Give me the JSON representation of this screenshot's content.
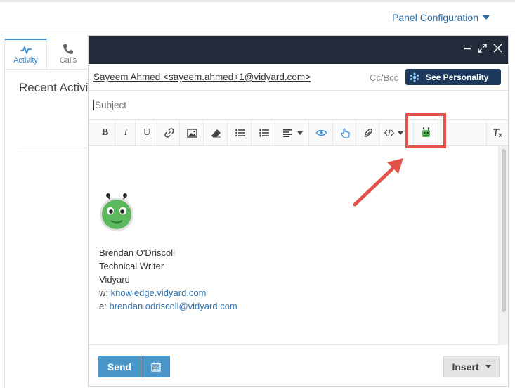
{
  "topbar": {
    "panel_config_label": "Panel Configuration"
  },
  "leftpanel": {
    "tabs": [
      {
        "label": "Activity",
        "icon": "activity-pulse-icon"
      },
      {
        "label": "Calls",
        "icon": "phone-icon"
      }
    ],
    "recent_heading": "Recent Activi"
  },
  "composer": {
    "recipient": "Sayeem Ahmed <sayeem.ahmed+1@vidyard.com>",
    "ccbcc_label": "Cc/Bcc",
    "personality_button": "See Personality",
    "subject_placeholder": "Subject",
    "toolbar": {
      "bold": "B",
      "italic": "I",
      "underline": "U",
      "icons": [
        "link-icon",
        "image-icon",
        "eraser-icon",
        "bullet-list-icon",
        "numbered-list-icon",
        "align-icon",
        "eye-icon",
        "pointer-icon",
        "paperclip-icon",
        "code-icon",
        "vidyard-icon",
        "clear-format-icon"
      ]
    },
    "signature": {
      "name": "Brendan O'Driscoll",
      "title": "Technical Writer",
      "company": "Vidyard",
      "website_prefix": "w: ",
      "website": "knowledge.vidyard.com",
      "email_prefix": "e: ",
      "email": "brendan.odriscoll@vidyard.com"
    },
    "footer": {
      "send_label": "Send",
      "insert_label": "Insert"
    }
  },
  "colors": {
    "titlebar": "#232b3a",
    "accent_blue": "#3a8fd6",
    "button_blue": "#4a96c9",
    "highlight_red": "#e2524b",
    "personality_navy": "#1d3a5c",
    "robot_green": "#5cb85c"
  }
}
